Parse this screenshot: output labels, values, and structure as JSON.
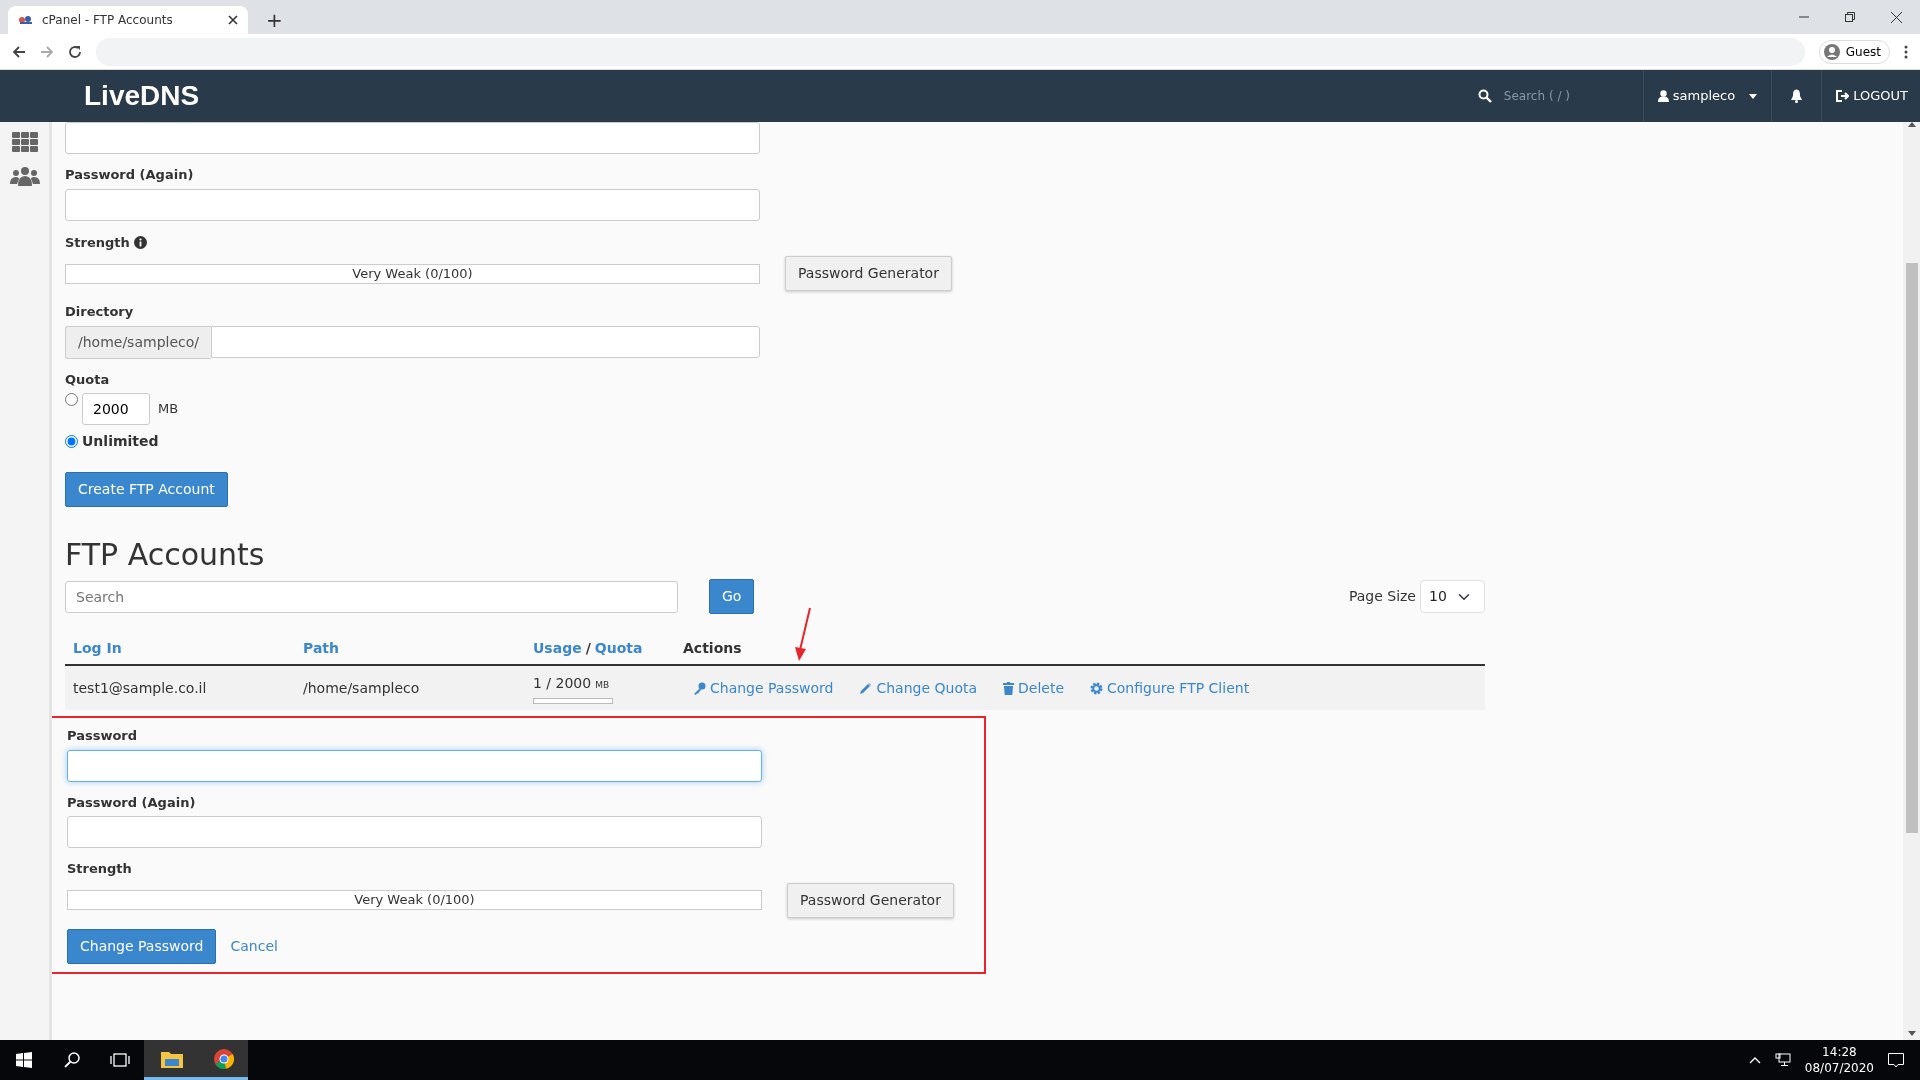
{
  "browser": {
    "tab_title": "cPanel - FTP Accounts",
    "new_tab": "+",
    "profile": "Guest"
  },
  "navbar": {
    "logo": "LiveDNS",
    "search_placeholder": "Search ( / )",
    "user": "sampleco",
    "logout": "LOGOUT"
  },
  "create_form": {
    "fields": [
      {
        "kind": "input"
      },
      {
        "kind": "input",
        "label": "Password (Again)"
      }
    ],
    "strength": {
      "label": "Strength",
      "meter_text": "Very Weak (0/100)",
      "level": 0,
      "generator": "Password Generator"
    },
    "directory": {
      "label": "Directory",
      "prefix": "/home/sampleco/"
    },
    "quota": {
      "label": "Quota",
      "options": [
        {
          "kind": "limited",
          "value": "2000",
          "unit": "MB",
          "selected": false
        },
        {
          "kind": "unlimited",
          "label": "Unlimited",
          "selected": true
        }
      ]
    },
    "submit": "Create FTP Account"
  },
  "accounts": {
    "heading": "FTP Accounts",
    "search_placeholder": "Search",
    "go": "Go",
    "page_size_label": "Page Size",
    "page_size": "10",
    "columns": [
      {
        "kind": "link",
        "label": "Log In"
      },
      {
        "kind": "link",
        "label": "Path"
      },
      {
        "kind": "usage",
        "usage": "Usage",
        "separator": "/",
        "quota": "Quota"
      },
      {
        "kind": "plain",
        "label": "Actions"
      }
    ],
    "rows": [
      {
        "login": "test1@sample.co.il",
        "path": "/home/sampleco",
        "usage": "1 / 2000",
        "unit": "MB",
        "level": 0,
        "actions": [
          {
            "label": "Change Password"
          },
          {
            "label": "Change Quota"
          },
          {
            "label": "Delete"
          },
          {
            "label": "Configure FTP Client"
          }
        ]
      }
    ]
  },
  "edit_form": {
    "highlighted": true,
    "fields": [
      {
        "label": "Password",
        "focused": true
      },
      {
        "label": "Password (Again)",
        "focused": false
      }
    ],
    "strength": {
      "label": "Strength",
      "meter_text": "Very Weak (0/100)",
      "level": 0,
      "generator": "Password Generator"
    },
    "submit": "Change Password",
    "cancel": "Cancel"
  },
  "annotation_arrow": true,
  "taskbar": {
    "time": "14:28",
    "date": "08/07/2020"
  }
}
